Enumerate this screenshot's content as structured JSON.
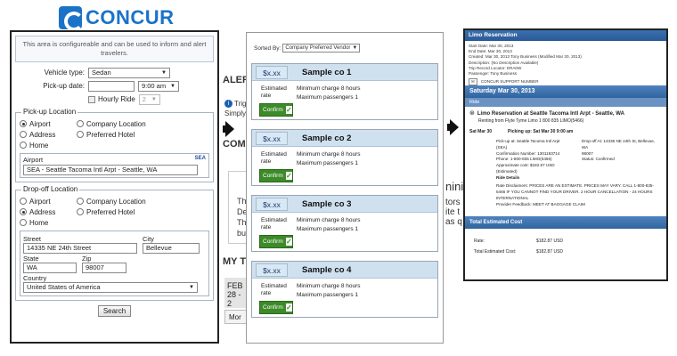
{
  "brand": {
    "name": "CONCUR",
    "color": "#1a73c8"
  },
  "background_page": {
    "alert_heading": "ALERT",
    "alert_line1": "Trig",
    "alert_line2": "Simply",
    "comp_heading": "COMI",
    "body_letters": [
      "Th",
      "De",
      "Th",
      "bu"
    ],
    "mini_word": "nini",
    "tors": "tors a",
    "ite": "ite t",
    "asq": "as q",
    "trips_heading": "MY TR",
    "date_month": "FEB",
    "date_range": "28 - 2",
    "more": "Mor"
  },
  "form": {
    "info": "This area is configureable and can be used to inform and alert travelers.",
    "vehicle_type_label": "Vehicle type:",
    "vehicle_type_value": "Sedan",
    "pickup_date_label": "Pick-up date:",
    "pickup_date_value": "",
    "pickup_time_value": "9:00 am",
    "hourly_ride_label": "Hourly Ride",
    "hourly_value": "2",
    "pickup_location": {
      "legend": "Pick-up Location",
      "options": [
        "Airport",
        "Company Location",
        "Address",
        "Preferred Hotel",
        "Home"
      ],
      "selected": "Airport",
      "airport_label": "Airport",
      "airport_code": "SEA",
      "airport_value": "SEA - Seattle Tacoma Intl Arpt - Seattle, WA"
    },
    "dropoff_location": {
      "legend": "Drop-off Location",
      "options": [
        "Airport",
        "Company Location",
        "Address",
        "Preferred Hotel",
        "Home"
      ],
      "selected": "Address",
      "street_label": "Street",
      "street_value": "14335 NE 24th Street",
      "city_label": "City",
      "city_value": "Bellevue",
      "state_label": "State",
      "state_value": "WA",
      "zip_label": "Zip",
      "zip_value": "98007",
      "country_label": "Country",
      "country_value": "United States of America"
    },
    "search_button": "Search"
  },
  "list": {
    "sort_label": "Sorted By:",
    "sort_value": "Company Preferred Vendor",
    "cards": [
      {
        "price": "$x.xx",
        "name": "Sample co 1",
        "est": "Estimated rate",
        "min_charge": "Minimum charge 8 hours",
        "max_pass": "Maximum passengers 1",
        "confirm": "Confirm"
      },
      {
        "price": "$x.xx",
        "name": "Sample co 2",
        "est": "Estimated rate",
        "min_charge": "Minimum charge 8 hours",
        "max_pass": "Maximum passengers 1",
        "confirm": "Confirm"
      },
      {
        "price": "$x.xx",
        "name": "Sample co  3",
        "est": "Estimated rate",
        "min_charge": "Minimum charge 8 hours",
        "max_pass": "Maximum passengers 1",
        "confirm": "Confirm"
      },
      {
        "price": "$x.xx",
        "name": "Sample co  4",
        "est": "Estimated rate",
        "min_charge": "Minimum charge 8 hours",
        "max_pass": "Maximum passengers 1",
        "confirm": "Confirm"
      }
    ]
  },
  "reservation": {
    "header": "Limo Reservation",
    "summary_lines": [
      "Start Date: Mar 30, 2013",
      "End Date: Mar 30, 2013",
      "Created: Mar 30, 2013 Tony Business (Modified Mar 30, 2013)",
      "Description: (No Description Available)",
      "Trip Record Locator: ERA0W",
      "Passenger: Tony Business"
    ],
    "support_label": "CONCUR SUPPORT NUMBER",
    "date_bar": "Saturday Mar 30, 2013",
    "ride_bar": "Ride",
    "ride_title": "Limo Reservation at Seattle Tacoma Intl Arpt - Seattle, WA",
    "ride_from": "Renting from Flyte Tyme Limo   1 800 835 LIMO(5466)",
    "ride_date": "Sat Mar 30",
    "picking_up": "Picking up: Sat Mar 30 9:00 am",
    "details_left": [
      "Pick-up at: Seattle Tacoma Intl Arpt",
      "(SEA)",
      "Confirmation Number: 1301193714",
      "Phone: 1-800-835 LIMO(5466)",
      "Approximate cost: $182.87 USD (Estimated)",
      "Ride Details"
    ],
    "details_right": [
      "Drop-off At: 14335 NE 24th St, Bellevue, WA",
      "98007",
      "Status: Confirmed"
    ],
    "disclaimer": "Rate Disclaimers: PRICES ARE AN ESTIMATE. PRICES MAY VARY. CALL 1-800-835-5466 IF YOU CANNOT FIND YOUR DRIVER. 2 HOUR CANCELLATION - 24 HOURS INTERNATIONAL",
    "provider_feedback": "Provider Feedback: MEET AT BAGGAGE CLAIM",
    "total_bar": "Total Estimated Cost",
    "rate_label": "Rate:",
    "rate_value": "$182.87 USD",
    "total_label": "Total Estimated Cost:",
    "total_value": "$182.87 USD"
  }
}
